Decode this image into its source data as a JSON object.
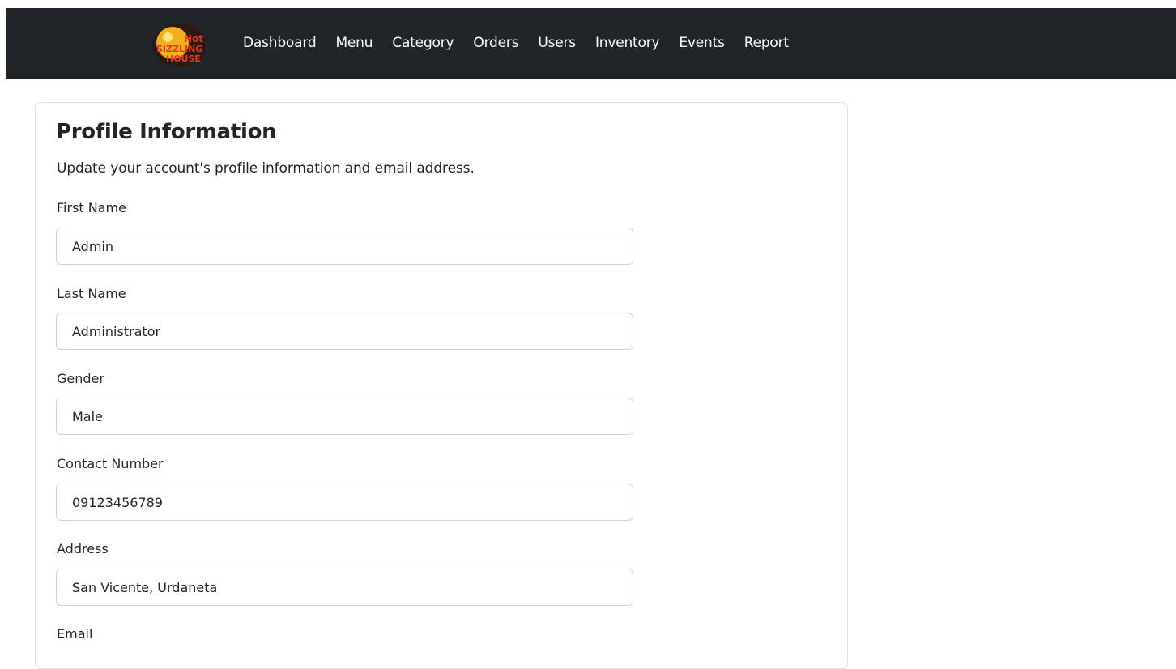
{
  "navbar": {
    "logo_alt": "logo",
    "links": [
      "Dashboard",
      "Menu",
      "Category",
      "Orders",
      "Users",
      "Inventory",
      "Events",
      "Report"
    ]
  },
  "profile": {
    "title": "Profile Information",
    "subtitle": "Update your account's profile information and email address.",
    "fields": [
      {
        "label": "First Name",
        "value": "Admin"
      },
      {
        "label": "Last Name",
        "value": "Administrator"
      },
      {
        "label": "Gender",
        "value": "Male"
      },
      {
        "label": "Contact Number",
        "value": "09123456789"
      },
      {
        "label": "Address",
        "value": "San Vicente, Urdaneta"
      },
      {
        "label": "Email",
        "value": ""
      }
    ]
  },
  "colors": {
    "navbar_bg": "#212529",
    "nav_text": "#ffffff",
    "card_border": "#dee2e6",
    "input_border": "#ced4da"
  }
}
